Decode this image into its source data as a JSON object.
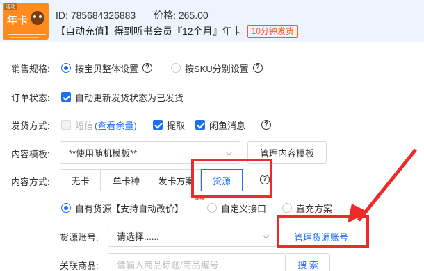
{
  "product": {
    "thumb_badge": "活动",
    "thumb_text": "年卡",
    "id_label": "ID:",
    "id_value": "785684326883",
    "price_label": "价格:",
    "price_value": "265.00",
    "title": "【自动充值】得到听书会员『12个月』年卡",
    "ship_tag": "10分钟发货"
  },
  "sales_spec": {
    "label": "销售规格:",
    "options": [
      "按宝贝整体设置",
      "按SKU分别设置"
    ],
    "selected": "按宝贝整体设置"
  },
  "order_status": {
    "label": "订单状态:",
    "checkbox_label": "自动更新发货状态为已发货"
  },
  "delivery": {
    "label": "发货方式:",
    "sms": "短信",
    "sms_link": "(查看余量)",
    "pickup": "提取",
    "xianyu": "闲鱼消息"
  },
  "template": {
    "label": "内容模板:",
    "value": "**使用随机模板**",
    "manage_button": "管理内容模板"
  },
  "content_mode": {
    "label": "内容方式:",
    "tabs": [
      "无卡",
      "单卡种",
      "发卡方案",
      "货源"
    ],
    "active": "货源",
    "new_tag": "new"
  },
  "source_type": {
    "options": [
      "自有货源【支持自动改价】",
      "自定义接口",
      "直充方案"
    ],
    "selected": "自有货源【支持自动改价】"
  },
  "source_account": {
    "label": "货源账号:",
    "placeholder": "请选择......",
    "manage_link": "管理货源账号"
  },
  "linked_product": {
    "label": "关联商品:",
    "placeholder": "请输入商品标题/商品编号",
    "search_button": "搜 索"
  },
  "colors": {
    "accent": "#1f6ff2",
    "annotation_red": "#ee2a2a",
    "tag_orange": "#f35b2f",
    "header_bg": "#eef4fd"
  }
}
